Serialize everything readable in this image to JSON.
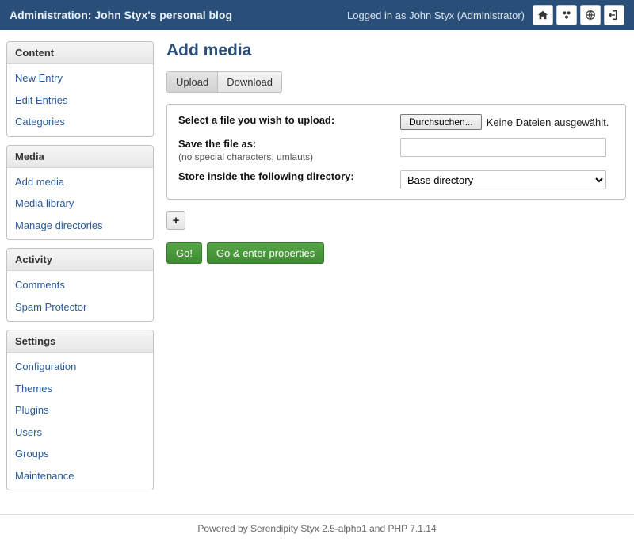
{
  "topbar": {
    "title": "Administration: John Styx's personal blog",
    "status": "Logged in as John Styx (Administrator)"
  },
  "sidebar": {
    "sections": [
      {
        "title": "Content",
        "items": [
          "New Entry",
          "Edit Entries",
          "Categories"
        ]
      },
      {
        "title": "Media",
        "items": [
          "Add media",
          "Media library",
          "Manage directories"
        ]
      },
      {
        "title": "Activity",
        "items": [
          "Comments",
          "Spam Protector"
        ]
      },
      {
        "title": "Settings",
        "items": [
          "Configuration",
          "Themes",
          "Plugins",
          "Users",
          "Groups",
          "Maintenance"
        ]
      }
    ]
  },
  "main": {
    "title": "Add media",
    "tabs": {
      "upload": "Upload",
      "download": "Download"
    },
    "form": {
      "select_label": "Select a file you wish to upload:",
      "browse_button": "Durchsuchen...",
      "browse_status": "Keine Dateien ausgewählt.",
      "save_label": "Save the file as:",
      "save_sublabel": "(no special characters, umlauts)",
      "save_value": "",
      "dir_label": "Store inside the following directory:",
      "dir_value": "Base directory"
    },
    "plus_label": "+",
    "go_button": "Go!",
    "go_enter_button": "Go & enter properties"
  },
  "footer": "Powered by Serendipity Styx 2.5-alpha1 and PHP 7.1.14"
}
